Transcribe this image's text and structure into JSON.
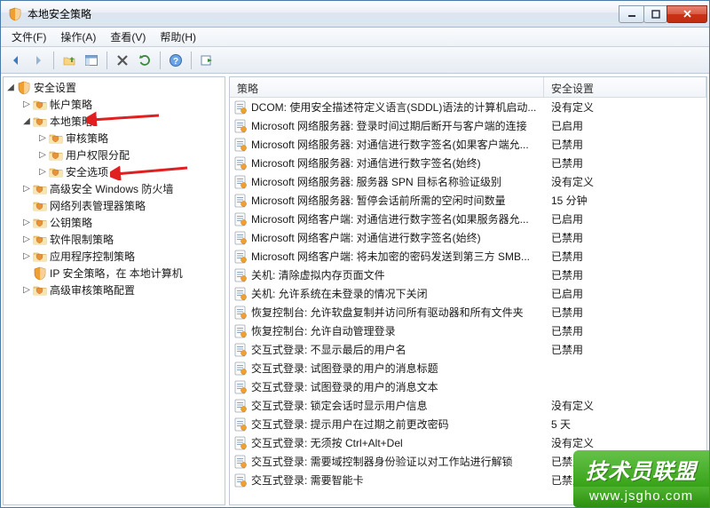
{
  "window": {
    "title": "本地安全策略"
  },
  "menu": {
    "file": "文件(F)",
    "action": "操作(A)",
    "view": "查看(V)",
    "help": "帮助(H)"
  },
  "tree": {
    "root": "安全设置",
    "account": "帐户策略",
    "local": "本地策略",
    "audit": "审核策略",
    "rights": "用户权限分配",
    "options": "安全选项",
    "firewall": "高级安全 Windows 防火墙",
    "netlist": "网络列表管理器策略",
    "pubkey": "公钥策略",
    "software": "软件限制策略",
    "appctrl": "应用程序控制策略",
    "ipsec": "IP 安全策略，在 本地计算机",
    "advaudit": "高级审核策略配置"
  },
  "columns": {
    "policy": "策略",
    "setting": "安全设置"
  },
  "values": {
    "undef": "没有定义",
    "enabled": "已启用",
    "disabled": "已禁用",
    "min15": "15 分钟",
    "days5": "5 天"
  },
  "rows": [
    {
      "name": "DCOM: 使用安全描述符定义语言(SDDL)语法的计算机启动...",
      "v": "undef"
    },
    {
      "name": "Microsoft 网络服务器: 登录时间过期后断开与客户端的连接",
      "v": "enabled"
    },
    {
      "name": "Microsoft 网络服务器: 对通信进行数字签名(如果客户端允...",
      "v": "disabled"
    },
    {
      "name": "Microsoft 网络服务器: 对通信进行数字签名(始终)",
      "v": "disabled"
    },
    {
      "name": "Microsoft 网络服务器: 服务器 SPN 目标名称验证级别",
      "v": "undef"
    },
    {
      "name": "Microsoft 网络服务器: 暂停会话前所需的空闲时间数量",
      "v": "min15"
    },
    {
      "name": "Microsoft 网络客户端: 对通信进行数字签名(如果服务器允...",
      "v": "enabled"
    },
    {
      "name": "Microsoft 网络客户端: 对通信进行数字签名(始终)",
      "v": "disabled"
    },
    {
      "name": "Microsoft 网络客户端: 将未加密的密码发送到第三方 SMB...",
      "v": "disabled"
    },
    {
      "name": "关机: 清除虚拟内存页面文件",
      "v": "disabled"
    },
    {
      "name": "关机: 允许系统在未登录的情况下关闭",
      "v": "enabled"
    },
    {
      "name": "恢复控制台: 允许软盘复制并访问所有驱动器和所有文件夹",
      "v": "disabled"
    },
    {
      "name": "恢复控制台: 允许自动管理登录",
      "v": "disabled"
    },
    {
      "name": "交互式登录: 不显示最后的用户名",
      "v": "disabled"
    },
    {
      "name": "交互式登录: 试图登录的用户的消息标题",
      "v": ""
    },
    {
      "name": "交互式登录: 试图登录的用户的消息文本",
      "v": ""
    },
    {
      "name": "交互式登录: 锁定会话时显示用户信息",
      "v": "undef"
    },
    {
      "name": "交互式登录: 提示用户在过期之前更改密码",
      "v": "days5"
    },
    {
      "name": "交互式登录: 无须按 Ctrl+Alt+Del",
      "v": "undef"
    },
    {
      "name": "交互式登录: 需要域控制器身份验证以对工作站进行解锁",
      "v": "disabled"
    },
    {
      "name": "交互式登录: 需要智能卡",
      "v": "disabled"
    }
  ],
  "watermark": {
    "title": "技术员联盟",
    "url": "www.jsgho.com"
  }
}
